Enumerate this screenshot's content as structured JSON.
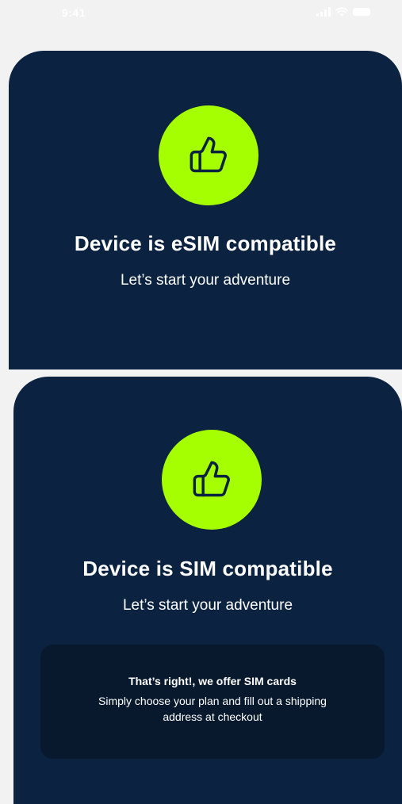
{
  "status_bar": {
    "time": "9:41",
    "icons": [
      "signal-icon",
      "wifi-icon",
      "battery-icon"
    ]
  },
  "colors": {
    "background": "#f2f2f2",
    "card": "#0b2340",
    "accent": "#a6ff00",
    "info_box": "#08192e",
    "text": "#ffffff"
  },
  "cards": [
    {
      "icon": "thumbs-up-icon",
      "title": "Device is eSIM compatible",
      "subtitle": "Let’s start your adventure"
    },
    {
      "icon": "thumbs-up-icon",
      "title": "Device is SIM compatible",
      "subtitle": "Let’s start your adventure",
      "info": {
        "heading": "That’s right!, we offer SIM cards",
        "body": "Simply choose your plan and fill out a shipping address at checkout"
      }
    }
  ]
}
